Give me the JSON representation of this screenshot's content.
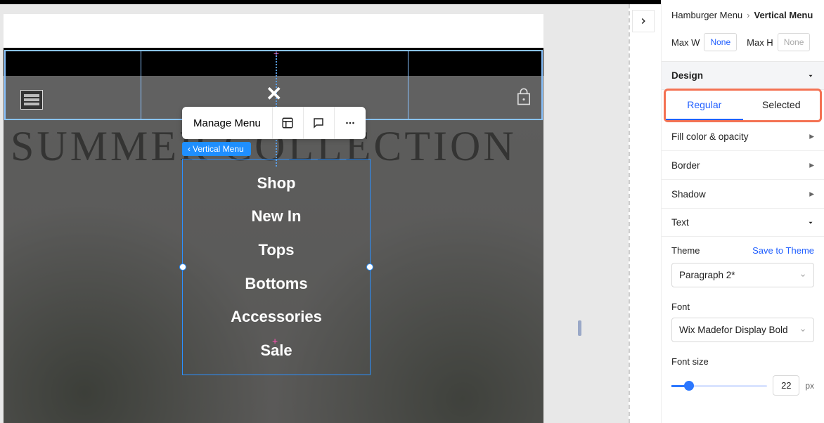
{
  "breadcrumb": {
    "parent": "Hamburger Menu",
    "sep": "›",
    "current": "Vertical Menu"
  },
  "max": {
    "w_label": "Max W",
    "w_value": "None",
    "h_label": "Max H",
    "h_value": "None"
  },
  "design": {
    "title": "Design",
    "tabs": {
      "regular": "Regular",
      "selected": "Selected"
    },
    "rows": {
      "fill": "Fill color & opacity",
      "border": "Border",
      "shadow": "Shadow",
      "text": "Text"
    },
    "theme": {
      "label": "Theme",
      "save": "Save to Theme",
      "value": "Paragraph 2*"
    },
    "font": {
      "label": "Font",
      "value": "Wix Madefor Display Bold"
    },
    "fontsize": {
      "label": "Font size",
      "value": "22",
      "unit": "px"
    }
  },
  "canvas": {
    "hero_text": "SUMMER COLLECTION",
    "close": "✕",
    "toolbar": {
      "manage": "Manage Menu"
    },
    "chip": "Vertical Menu",
    "menu": [
      "Shop",
      "New In",
      "Tops",
      "Bottoms",
      "Accessories",
      "Sale"
    ]
  }
}
